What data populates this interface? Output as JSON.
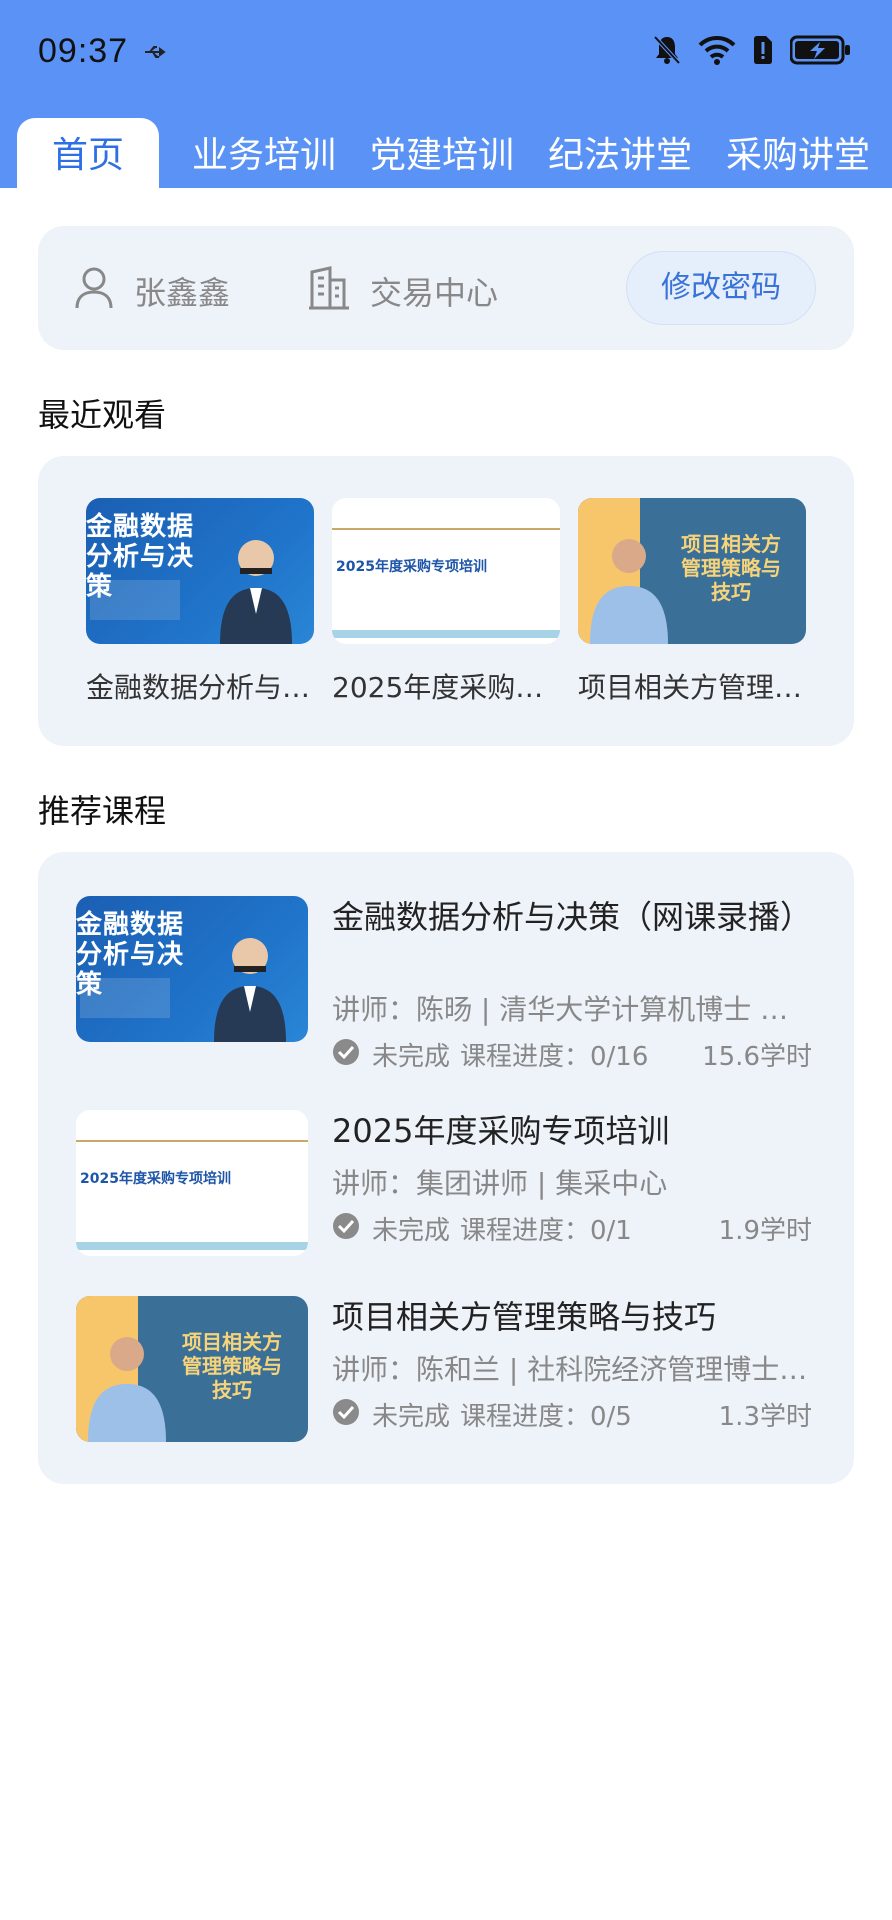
{
  "status_bar": {
    "time": "09:37"
  },
  "tabs": [
    {
      "label": "首页"
    },
    {
      "label": "业务培训"
    },
    {
      "label": "党建培训"
    },
    {
      "label": "纪法讲堂"
    },
    {
      "label": "采购讲堂"
    }
  ],
  "user": {
    "name": "张鑫鑫",
    "org": "交易中心",
    "change_password_label": "修改密码"
  },
  "recent": {
    "title": "最近观看",
    "items": [
      {
        "title": "金融数据分析与…",
        "thumb_title": "金融数据分析与决策"
      },
      {
        "title": "2025年度采购…",
        "thumb_title": "2025年度采购专项培训"
      },
      {
        "title": "项目相关方管理…",
        "thumb_title": "项目相关方管理策略与技巧"
      }
    ]
  },
  "recommended": {
    "title": "推荐课程",
    "courses": [
      {
        "title": "金融数据分析与决策（网课录播）",
        "teacher": "讲师：陈旸 | 清华大学计算机博士 全…",
        "status": "未完成",
        "progress": "课程进度：0/16",
        "hours": "15.6学时",
        "thumb_title": "金融数据分析与决策"
      },
      {
        "title": "2025年度采购专项培训",
        "teacher": "讲师：集团讲师 | 集采中心",
        "status": "未完成",
        "progress": "课程进度：0/1",
        "hours": "1.9学时",
        "thumb_title": "2025年度采购专项培训"
      },
      {
        "title": "项目相关方管理策略与技巧",
        "teacher": "讲师：陈和兰 | 社科院经济管理博士…",
        "status": "未完成",
        "progress": "课程进度：0/5",
        "hours": "1.3学时",
        "thumb_title": "项目相关方管理策略与技巧"
      }
    ]
  },
  "colors": {
    "header_bg": "#5a93f5",
    "accent": "#2e6fe6",
    "card_bg": "#eef3fa"
  }
}
